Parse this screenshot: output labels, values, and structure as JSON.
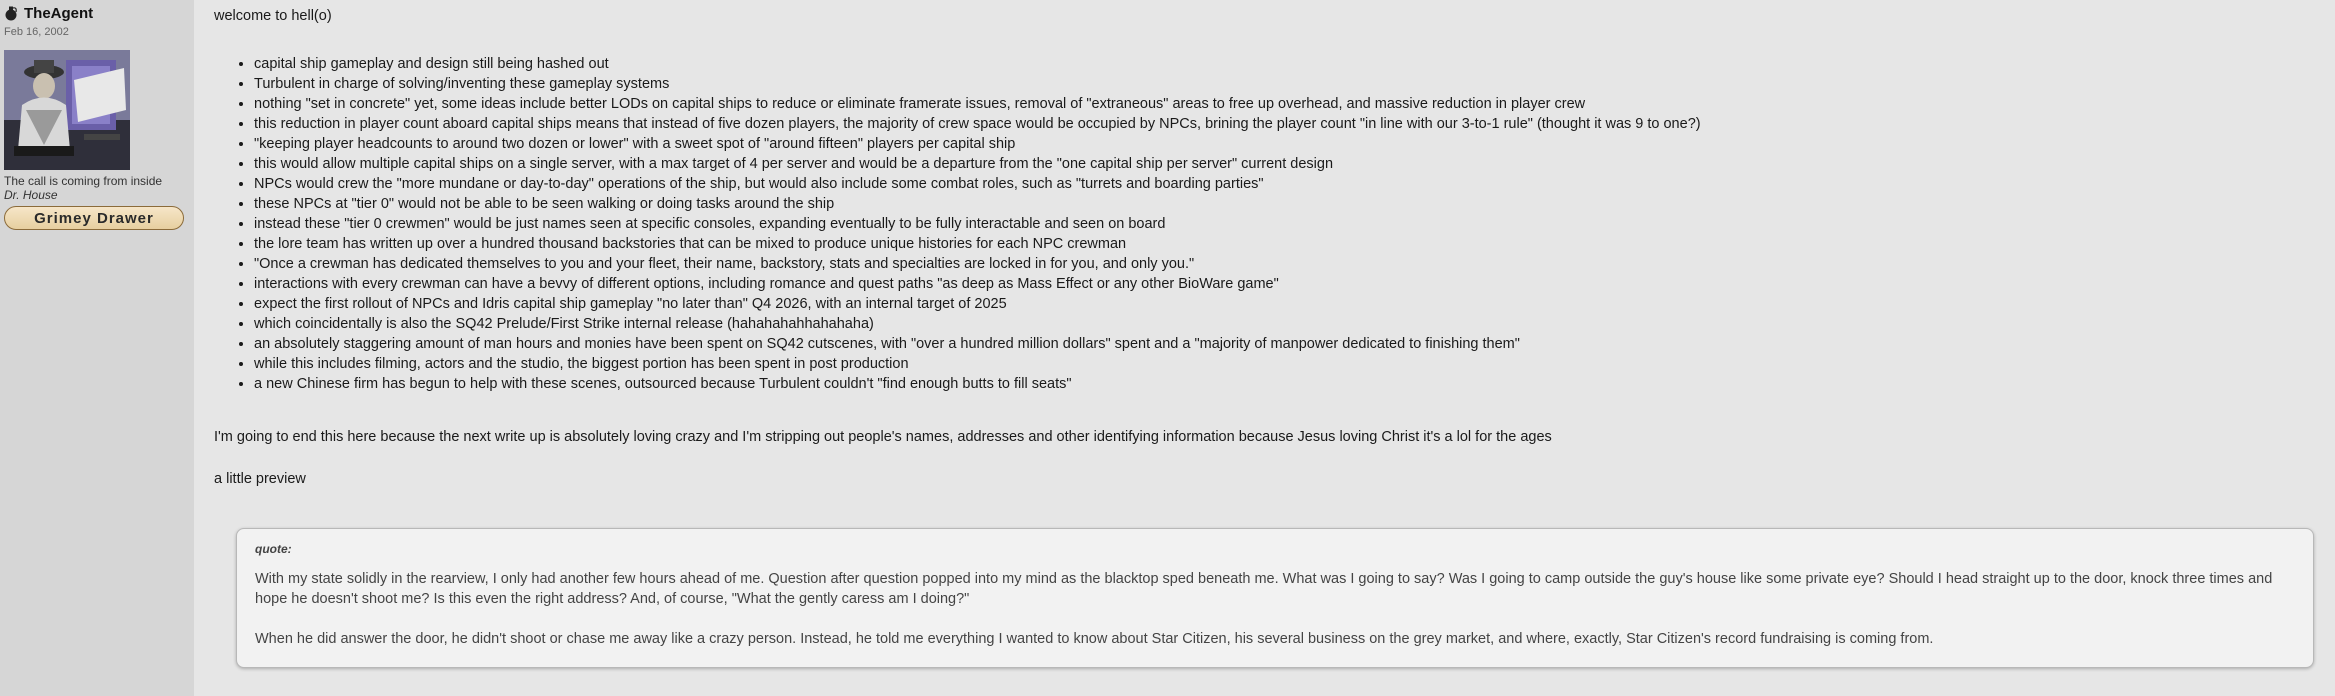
{
  "user": {
    "name": "TheAgent",
    "reg_date": "Feb 16, 2002",
    "title_line1": "The call is coming from inside",
    "title_line2": "Dr. House",
    "badge": "Grimey Drawer"
  },
  "post": {
    "intro": "welcome to hell(o)",
    "bullets": [
      "capital ship gameplay and design still being hashed out",
      "Turbulent in charge of solving/inventing these gameplay systems",
      "nothing \"set in concrete\" yet, some ideas include better LODs on capital ships to reduce or eliminate framerate issues, removal of \"extraneous\" areas to free up overhead, and massive reduction in player crew",
      "this reduction in player count aboard capital ships means that instead of five dozen players, the majority of crew space would be occupied by NPCs, brining the player count \"in line with our 3-to-1 rule\" (thought it was 9 to one?)",
      "\"keeping player headcounts to around two dozen or lower\" with a sweet spot of \"around fifteen\" players per capital ship",
      "this would allow multiple capital ships on a single server, with a max target of 4 per server and would be a departure from the \"one capital ship per server\" current design",
      "NPCs would crew the \"more mundane or day-to-day\" operations of the ship, but would also include some combat roles, such as \"turrets and boarding parties\"",
      "these NPCs at \"tier 0\" would not be able to be seen walking or doing tasks around the ship",
      "instead these \"tier 0 crewmen\" would be just names seen at specific consoles, expanding eventually to be fully interactable and seen on board",
      "the lore team has written up over a hundred thousand backstories that can be mixed to produce unique histories for each NPC crewman",
      "\"Once a crewman has dedicated themselves to you and your fleet, their name, backstory, stats and specialties are locked in for you, and only you.\"",
      "interactions with every crewman can have a bevvy of different options, including romance and quest paths \"as deep as Mass Effect or any other BioWare game\"",
      "expect the first rollout of NPCs and Idris capital ship gameplay \"no later than\" Q4 2026, with an internal target of 2025",
      "which coincidentally is also the SQ42 Prelude/First Strike internal release (hahahahahhahahaha)",
      "an absolutely staggering amount of man hours and monies have been spent on SQ42 cutscenes, with \"over a hundred million dollars\" spent and a \"majority of manpower dedicated to finishing them\"",
      "while this includes filming, actors and the studio, the biggest portion has been spent in post production",
      "a new Chinese firm has begun to help with these scenes, outsourced because Turbulent couldn't \"find enough butts to fill seats\""
    ],
    "paragraph1": "I'm going to end this here because the next write up is absolutely loving crazy and I'm stripping out people's names, addresses and other identifying information because Jesus loving Christ it's a lol for the ages",
    "paragraph2": "a little preview"
  },
  "quote": {
    "label": "quote:",
    "p1": "With my state solidly in the rearview, I only had another few hours ahead of me. Question after question popped into my mind as the blacktop sped beneath me. What was I going to say? Was I going to camp outside the guy's house like some private eye? Should I head straight up to the door, knock three times and hope he doesn't shoot me? Is this even the right address? And, of course, \"What the gently caress am I doing?\"",
    "p2": "When he did answer the door, he didn't shoot or chase me away like a crazy person. Instead, he told me everything I wanted to know about Star Citizen, his several business on the grey market, and where, exactly, Star Citizen's record fundraising is coming from."
  },
  "colors": {
    "page_bg": "#e6e6e6",
    "sidebar_bg": "#d6d6d6",
    "quote_bg": "#f2f2f2",
    "badge_bg": "#f0ddb5"
  },
  "icons": {
    "user_icon": "grenade-icon"
  }
}
